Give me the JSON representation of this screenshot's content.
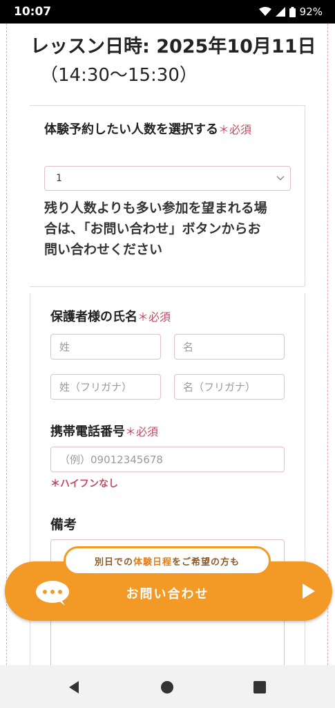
{
  "status": {
    "time": "10:07",
    "battery": "92%"
  },
  "lesson": {
    "title": "レッスン日時: 2025年10月11日",
    "time_range": "（14:30〜15:30）"
  },
  "form": {
    "people": {
      "label": "体験予約したい人数を選択する",
      "required": "＊必須",
      "selected": "1"
    },
    "note": "残り人数よりも多い参加を望まれる場合は、「お問い合わせ」ボタンからお問い合わせください",
    "guardian": {
      "label": "保護者様の氏名",
      "required": "＊必須",
      "last_name_placeholder": "姓",
      "first_name_placeholder": "名",
      "last_kana_placeholder": "姓（フリガナ）",
      "first_kana_placeholder": "名（フリガナ）"
    },
    "phone": {
      "label": "携帯電話番号",
      "required": "＊必須",
      "placeholder": "（例）09012345678",
      "note": "＊ハイフンなし"
    },
    "remarks": {
      "label": "備考"
    }
  },
  "cta": {
    "tag_pre": "別日での",
    "tag_hl": "体験日程",
    "tag_post": "をご希望の方も",
    "label": "お問い合わせ",
    "accent": "#f39a26"
  }
}
